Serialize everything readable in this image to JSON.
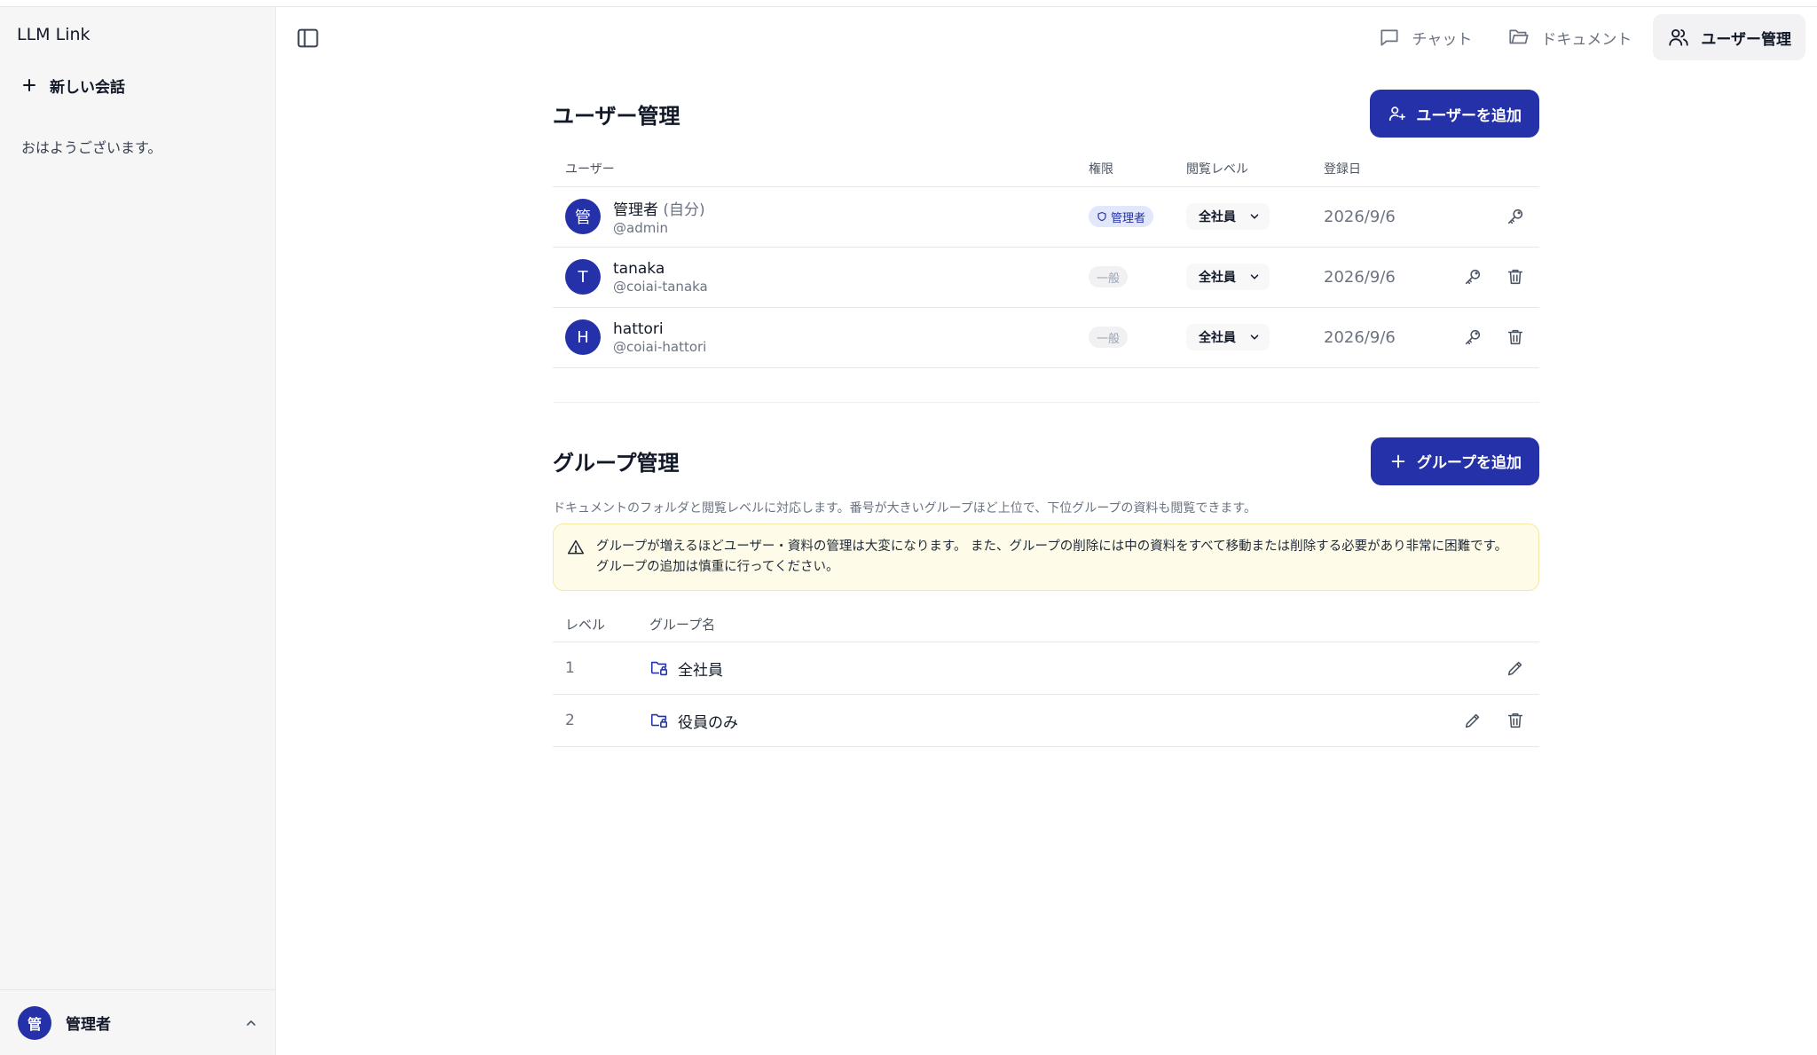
{
  "app": {
    "title": "LLM Link"
  },
  "sidebar": {
    "new_chat_label": "新しい会話",
    "greeting": "おはようございます。",
    "footer": {
      "avatar_initial": "管",
      "user_name": "管理者"
    }
  },
  "topnav": {
    "items": [
      {
        "label": "チャット",
        "icon": "chat-icon",
        "active": false
      },
      {
        "label": "ドキュメント",
        "icon": "folder-icon",
        "active": false
      },
      {
        "label": "ユーザー管理",
        "icon": "users-icon",
        "active": true
      }
    ]
  },
  "users_section": {
    "title": "ユーザー管理",
    "add_button_label": "ユーザーを追加",
    "columns": [
      "ユーザー",
      "権限",
      "閲覧レベル",
      "登録日"
    ],
    "rows": [
      {
        "initial": "管",
        "name": "管理者",
        "self_label": "(自分)",
        "handle": "@admin",
        "role": "管理者",
        "role_type": "admin",
        "level": "全社員",
        "date": "2026/9/6",
        "can_delete": false
      },
      {
        "initial": "T",
        "name": "tanaka",
        "self_label": "",
        "handle": "@coiai-tanaka",
        "role": "一般",
        "role_type": "general",
        "level": "全社員",
        "date": "2026/9/6",
        "can_delete": true
      },
      {
        "initial": "H",
        "name": "hattori",
        "self_label": "",
        "handle": "@coiai-hattori",
        "role": "一般",
        "role_type": "general",
        "level": "全社員",
        "date": "2026/9/6",
        "can_delete": true
      }
    ]
  },
  "groups_section": {
    "title": "グループ管理",
    "add_button_label": "グループを追加",
    "description": "ドキュメントのフォルダと閲覧レベルに対応します。番号が大きいグループほど上位で、下位グループの資料も閲覧できます。",
    "warning": "グループが増えるほどユーザー・資料の管理は大変になります。 また、グループの削除には中の資料をすべて移動または削除する必要があり非常に困難です。 グループの追加は慎重に行ってください。",
    "columns": [
      "レベル",
      "グループ名"
    ],
    "rows": [
      {
        "level": "1",
        "name": "全社員",
        "can_delete": false
      },
      {
        "level": "2",
        "name": "役員のみ",
        "can_delete": true
      }
    ]
  },
  "colors": {
    "accent": "#2431a8",
    "warning_bg": "#fefbe8",
    "sidebar_bg": "#f6f6f7"
  }
}
